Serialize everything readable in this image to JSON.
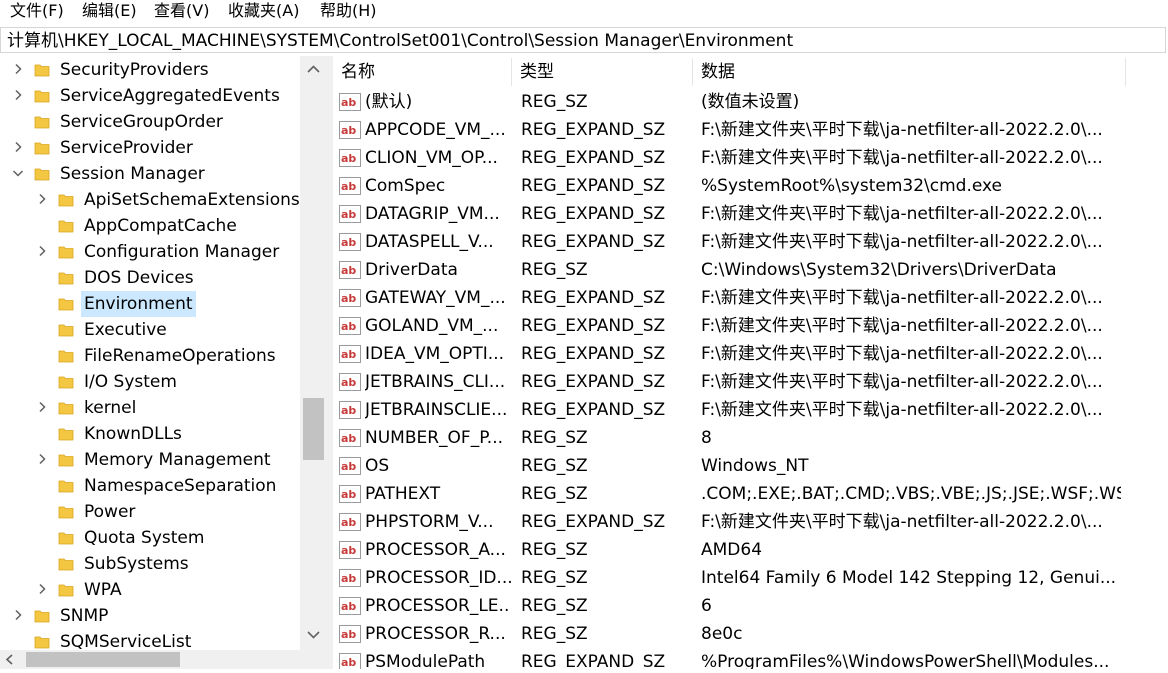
{
  "menu": [
    "文件(F)",
    "编辑(E)",
    "查看(V)",
    "收藏夹(A)",
    "帮助(H)"
  ],
  "address": "计算机\\HKEY_LOCAL_MACHINE\\SYSTEM\\ControlSet001\\Control\\Session Manager\\Environment",
  "tree": [
    {
      "label": "SecurityProviders",
      "level": 0,
      "expander": "collapsed"
    },
    {
      "label": "ServiceAggregatedEvents",
      "level": 0,
      "expander": "collapsed"
    },
    {
      "label": "ServiceGroupOrder",
      "level": 0,
      "expander": "none"
    },
    {
      "label": "ServiceProvider",
      "level": 0,
      "expander": "collapsed"
    },
    {
      "label": "Session Manager",
      "level": 0,
      "expander": "expanded"
    },
    {
      "label": "ApiSetSchemaExtensions",
      "level": 1,
      "expander": "collapsed"
    },
    {
      "label": "AppCompatCache",
      "level": 1,
      "expander": "none"
    },
    {
      "label": "Configuration Manager",
      "level": 1,
      "expander": "collapsed"
    },
    {
      "label": "DOS Devices",
      "level": 1,
      "expander": "none"
    },
    {
      "label": "Environment",
      "level": 1,
      "expander": "none",
      "selected": true
    },
    {
      "label": "Executive",
      "level": 1,
      "expander": "none"
    },
    {
      "label": "FileRenameOperations",
      "level": 1,
      "expander": "none"
    },
    {
      "label": "I/O System",
      "level": 1,
      "expander": "none"
    },
    {
      "label": "kernel",
      "level": 1,
      "expander": "collapsed"
    },
    {
      "label": "KnownDLLs",
      "level": 1,
      "expander": "none"
    },
    {
      "label": "Memory Management",
      "level": 1,
      "expander": "collapsed"
    },
    {
      "label": "NamespaceSeparation",
      "level": 1,
      "expander": "none"
    },
    {
      "label": "Power",
      "level": 1,
      "expander": "none"
    },
    {
      "label": "Quota System",
      "level": 1,
      "expander": "none"
    },
    {
      "label": "SubSystems",
      "level": 1,
      "expander": "none"
    },
    {
      "label": "WPA",
      "level": 1,
      "expander": "collapsed"
    },
    {
      "label": "SNMP",
      "level": 0,
      "expander": "collapsed"
    },
    {
      "label": "SQMServiceList",
      "level": 0,
      "expander": "none"
    }
  ],
  "columns": {
    "name": "名称",
    "type": "类型",
    "data": "数据"
  },
  "rows": [
    {
      "name": "(默认)",
      "type": "REG_SZ",
      "data": "(数值未设置)"
    },
    {
      "name": "APPCODE_VM_...",
      "type": "REG_EXPAND_SZ",
      "data": "F:\\新建文件夹\\平时下载\\ja-netfilter-all-2022.2.0\\..."
    },
    {
      "name": "CLION_VM_OP...",
      "type": "REG_EXPAND_SZ",
      "data": "F:\\新建文件夹\\平时下载\\ja-netfilter-all-2022.2.0\\..."
    },
    {
      "name": "ComSpec",
      "type": "REG_EXPAND_SZ",
      "data": "%SystemRoot%\\system32\\cmd.exe"
    },
    {
      "name": "DATAGRIP_VM...",
      "type": "REG_EXPAND_SZ",
      "data": "F:\\新建文件夹\\平时下载\\ja-netfilter-all-2022.2.0\\..."
    },
    {
      "name": "DATASPELL_V...",
      "type": "REG_EXPAND_SZ",
      "data": "F:\\新建文件夹\\平时下载\\ja-netfilter-all-2022.2.0\\..."
    },
    {
      "name": "DriverData",
      "type": "REG_SZ",
      "data": "C:\\Windows\\System32\\Drivers\\DriverData"
    },
    {
      "name": "GATEWAY_VM_...",
      "type": "REG_EXPAND_SZ",
      "data": "F:\\新建文件夹\\平时下载\\ja-netfilter-all-2022.2.0\\..."
    },
    {
      "name": "GOLAND_VM_...",
      "type": "REG_EXPAND_SZ",
      "data": "F:\\新建文件夹\\平时下载\\ja-netfilter-all-2022.2.0\\..."
    },
    {
      "name": "IDEA_VM_OPTI...",
      "type": "REG_EXPAND_SZ",
      "data": "F:\\新建文件夹\\平时下载\\ja-netfilter-all-2022.2.0\\..."
    },
    {
      "name": "JETBRAINS_CLI...",
      "type": "REG_EXPAND_SZ",
      "data": "F:\\新建文件夹\\平时下载\\ja-netfilter-all-2022.2.0\\..."
    },
    {
      "name": "JETBRAINSCLIE...",
      "type": "REG_EXPAND_SZ",
      "data": "F:\\新建文件夹\\平时下载\\ja-netfilter-all-2022.2.0\\..."
    },
    {
      "name": "NUMBER_OF_P...",
      "type": "REG_SZ",
      "data": "8"
    },
    {
      "name": "OS",
      "type": "REG_SZ",
      "data": "Windows_NT"
    },
    {
      "name": "PATHEXT",
      "type": "REG_SZ",
      "data": ".COM;.EXE;.BAT;.CMD;.VBS;.VBE;.JS;.JSE;.WSF;.WS..."
    },
    {
      "name": "PHPSTORM_V...",
      "type": "REG_EXPAND_SZ",
      "data": "F:\\新建文件夹\\平时下载\\ja-netfilter-all-2022.2.0\\..."
    },
    {
      "name": "PROCESSOR_A...",
      "type": "REG_SZ",
      "data": "AMD64"
    },
    {
      "name": "PROCESSOR_ID...",
      "type": "REG_SZ",
      "data": "Intel64 Family 6 Model 142 Stepping 12, Genui..."
    },
    {
      "name": "PROCESSOR_LE...",
      "type": "REG_SZ",
      "data": "6"
    },
    {
      "name": "PROCESSOR_R...",
      "type": "REG_SZ",
      "data": "8e0c"
    },
    {
      "name": "PSModulePath",
      "type": "REG_EXPAND_SZ",
      "data": "%ProgramFiles%\\WindowsPowerShell\\Modules..."
    }
  ],
  "icons": {
    "value": "string-value-icon",
    "folder": "folder-icon"
  },
  "colors": {
    "selection": "#cce8ff",
    "folder": "#f4c743",
    "value_icon": "#c83a3a"
  }
}
